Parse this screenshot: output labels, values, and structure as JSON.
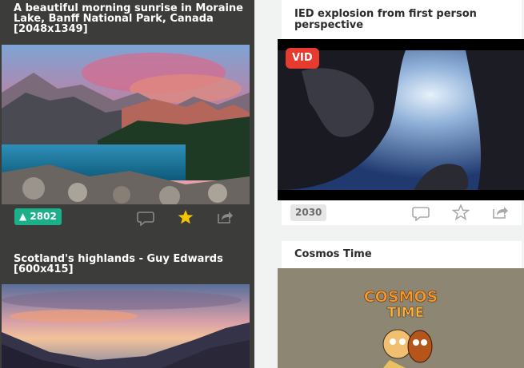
{
  "feed_left": {
    "post1": {
      "title": "A beautiful morning sunrise in Moraine Lake, Banff National Park, Canada [2048x1349]",
      "upvotes": "▲ 2802",
      "icons": [
        "comment-icon",
        "star-filled-icon",
        "share-icon"
      ],
      "accent_color": "#1bb08a",
      "star_color": "#f5c400"
    },
    "post2": {
      "title": "Scotland's highlands - Guy Edwards [600x415]"
    }
  },
  "feed_right": {
    "post1": {
      "title": "IED explosion from first person perspective",
      "badge": "VID",
      "score": "2030",
      "icons": [
        "comment-icon",
        "star-outline-icon",
        "share-icon"
      ],
      "badge_color": "#e63b2e"
    },
    "post2": {
      "title": "Cosmos Time",
      "art_text_1": "COSMOS",
      "art_text_2": "TIME"
    }
  }
}
